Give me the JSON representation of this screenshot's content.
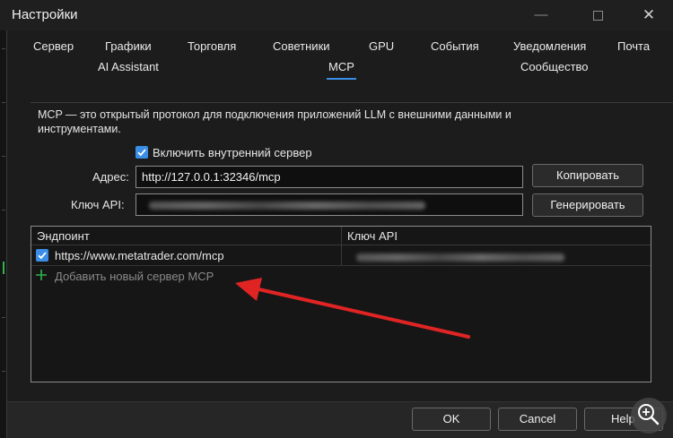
{
  "window": {
    "title": "Настройки",
    "minimize_glyph": "—",
    "close_glyph": "✕"
  },
  "tabs_row1": [
    "Сервер",
    "Графики",
    "Торговля",
    "Советники",
    "GPU",
    "События",
    "Уведомления",
    "Почта"
  ],
  "tabs_row2": [
    "AI Assistant",
    "MCP",
    "Сообщество"
  ],
  "active_tab": "MCP",
  "mcp": {
    "description": "MCP — это открытый протокол для подключения приложений LLM с внешними данными и инструментами.",
    "enable_label": "Включить внутренний сервер",
    "enable_checked": true,
    "address_label": "Адрес:",
    "address_value": "http://127.0.0.1:32346/mcp",
    "api_key_label": "Ключ API:",
    "copy_button": "Копировать",
    "generate_button": "Генерировать"
  },
  "table": {
    "columns": [
      "Эндпоинт",
      "Ключ API"
    ],
    "rows": [
      {
        "endpoint": "https://www.metatrader.com/mcp",
        "checked": true
      }
    ],
    "add_label": "Добавить новый сервер MCP"
  },
  "footer": {
    "ok": "OK",
    "cancel": "Cancel",
    "help": "Help"
  },
  "colors": {
    "accent": "#3a8ee6",
    "arrow": "#e02424",
    "plus": "#2fb34a"
  },
  "icons": [
    "minimize-icon",
    "maximize-icon",
    "close-icon",
    "checkmark-icon",
    "plus-icon",
    "zoom-in-icon",
    "annotation-arrow"
  ]
}
